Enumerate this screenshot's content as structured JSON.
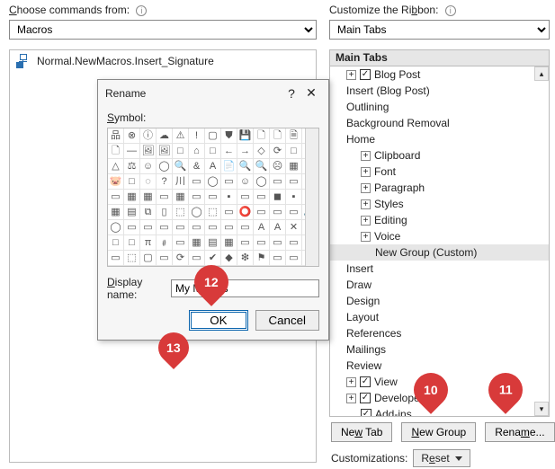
{
  "left": {
    "label_html": "Choose commands from:",
    "dropdown_value": "Macros",
    "macro_name": "Normal.NewMacros.Insert_Signature"
  },
  "right": {
    "label_html": "Customize the Ribbon:",
    "dropdown_value": "Main Tabs",
    "header": "Main Tabs",
    "tree": [
      {
        "indent": 1,
        "exp": "+",
        "check": true,
        "label": "Blog Post"
      },
      {
        "indent": 1,
        "exp": "",
        "check": null,
        "label": "Insert (Blog Post)"
      },
      {
        "indent": 1,
        "exp": "",
        "check": null,
        "label": "Outlining"
      },
      {
        "indent": 1,
        "exp": "",
        "check": null,
        "label": "Background Removal"
      },
      {
        "indent": 1,
        "exp": "",
        "check": null,
        "label": "Home"
      },
      {
        "indent": 2,
        "exp": "+",
        "check": null,
        "label": "Clipboard"
      },
      {
        "indent": 2,
        "exp": "+",
        "check": null,
        "label": "Font"
      },
      {
        "indent": 2,
        "exp": "+",
        "check": null,
        "label": "Paragraph"
      },
      {
        "indent": 2,
        "exp": "+",
        "check": null,
        "label": "Styles"
      },
      {
        "indent": 2,
        "exp": "+",
        "check": null,
        "label": "Editing"
      },
      {
        "indent": 2,
        "exp": "+",
        "check": null,
        "label": "Voice"
      },
      {
        "indent": 3,
        "exp": "",
        "check": null,
        "label": "New Group (Custom)",
        "selected": true
      },
      {
        "indent": 1,
        "exp": "",
        "check": null,
        "label": "Insert"
      },
      {
        "indent": 1,
        "exp": "",
        "check": null,
        "label": "Draw"
      },
      {
        "indent": 1,
        "exp": "",
        "check": null,
        "label": "Design"
      },
      {
        "indent": 1,
        "exp": "",
        "check": null,
        "label": "Layout"
      },
      {
        "indent": 1,
        "exp": "",
        "check": null,
        "label": "References"
      },
      {
        "indent": 1,
        "exp": "",
        "check": null,
        "label": "Mailings"
      },
      {
        "indent": 1,
        "exp": "",
        "check": null,
        "label": "Review"
      },
      {
        "indent": 1,
        "exp": "+",
        "check": true,
        "label": "View"
      },
      {
        "indent": 1,
        "exp": "+",
        "check": true,
        "label": "Developer"
      },
      {
        "indent": 2,
        "exp": "",
        "check": true,
        "label": "Add-ins"
      }
    ]
  },
  "buttons": {
    "new_tab": "New Tab",
    "new_group": "New Group",
    "rename": "Rename...",
    "customizations_label": "Customizations:",
    "reset": "Reset"
  },
  "dialog": {
    "title": "Rename",
    "symbol_label": "Symbol:",
    "display_name_label": "Display name:",
    "display_name_value": "My Macros",
    "ok": "OK",
    "cancel": "Cancel",
    "symbols": [
      "品",
      "⊗",
      "ⓘ",
      "☁",
      "⚠",
      "!",
      "▢",
      "⛊",
      "💾",
      "🗋",
      "🗋",
      "🗎",
      "▭",
      "🗋",
      "—",
      "🖼",
      "🖼",
      "□",
      "⌂",
      "□",
      "←",
      "→",
      "◇",
      "⟳",
      "□",
      "⚲",
      "△",
      "⚖",
      "☺",
      "◯",
      "🔍",
      "&",
      "A",
      "📄",
      "🔍",
      "🔍",
      "☹",
      "▦",
      "▭",
      "🐷",
      "□",
      "◌",
      "?",
      "川",
      "▭",
      "◯",
      "▭",
      "☺",
      "◯",
      "▭",
      "▭",
      "▭",
      "▭",
      "▦",
      "▦",
      "▭",
      "▦",
      "▭",
      "▭",
      "▪",
      "▭",
      "▭",
      "◼",
      "▪",
      "▭",
      "▦",
      "▤",
      "⧉",
      "▯",
      "⬚",
      "◯",
      "⬚",
      "▭",
      "⭕",
      "▭",
      "▭",
      "▭",
      "🔉",
      "◯",
      "▭",
      "▭",
      "▭",
      "▭",
      "▭",
      "▭",
      "▭",
      "▭",
      "Α",
      "Α",
      "✕",
      "✔",
      "□",
      "□",
      "π",
      "﹟",
      "▭",
      "▦",
      "▤",
      "▦",
      "▭",
      "▭",
      "▭",
      "▭",
      "⬯",
      "▭",
      "⬚",
      "▢",
      "▭",
      "⟳",
      "▭",
      "✔",
      "◆",
      "❇",
      "⚑",
      "▭",
      "▭",
      "▭"
    ]
  },
  "callouts": {
    "c10": "10",
    "c11": "11",
    "c12": "12",
    "c13": "13"
  }
}
